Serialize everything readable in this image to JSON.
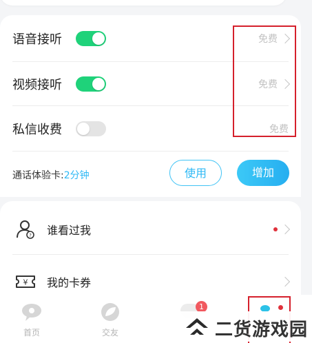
{
  "settings": {
    "voice_answer": {
      "label": "语音接听",
      "enabled": true,
      "price": "免费"
    },
    "video_answer": {
      "label": "视频接听",
      "enabled": true,
      "price": "免费"
    },
    "private_msg_fee": {
      "label": "私信收费",
      "enabled": false,
      "price": "免费"
    }
  },
  "call_card": {
    "label_prefix": "通话体验卡:",
    "value": "2分钟",
    "use_button": "使用",
    "add_button": "增加"
  },
  "menu": [
    {
      "label": "谁看过我",
      "icon": "person-question-icon",
      "has_red_dot": true
    },
    {
      "label": "我的卡券",
      "icon": "coupon-yen-icon",
      "has_red_dot": false
    }
  ],
  "tabbar": {
    "items": [
      {
        "label": "首页",
        "icon": "home-chat-icon"
      },
      {
        "label": "交友",
        "icon": "leaf-icon"
      }
    ],
    "message_badge": "1"
  },
  "watermark": {
    "text": "二货游戏园"
  },
  "colors": {
    "toggle_on": "#1fd27a",
    "accent_blue": "#2db8f5",
    "annotation_red": "#d51f2b",
    "badge_red": "#f1595f"
  }
}
